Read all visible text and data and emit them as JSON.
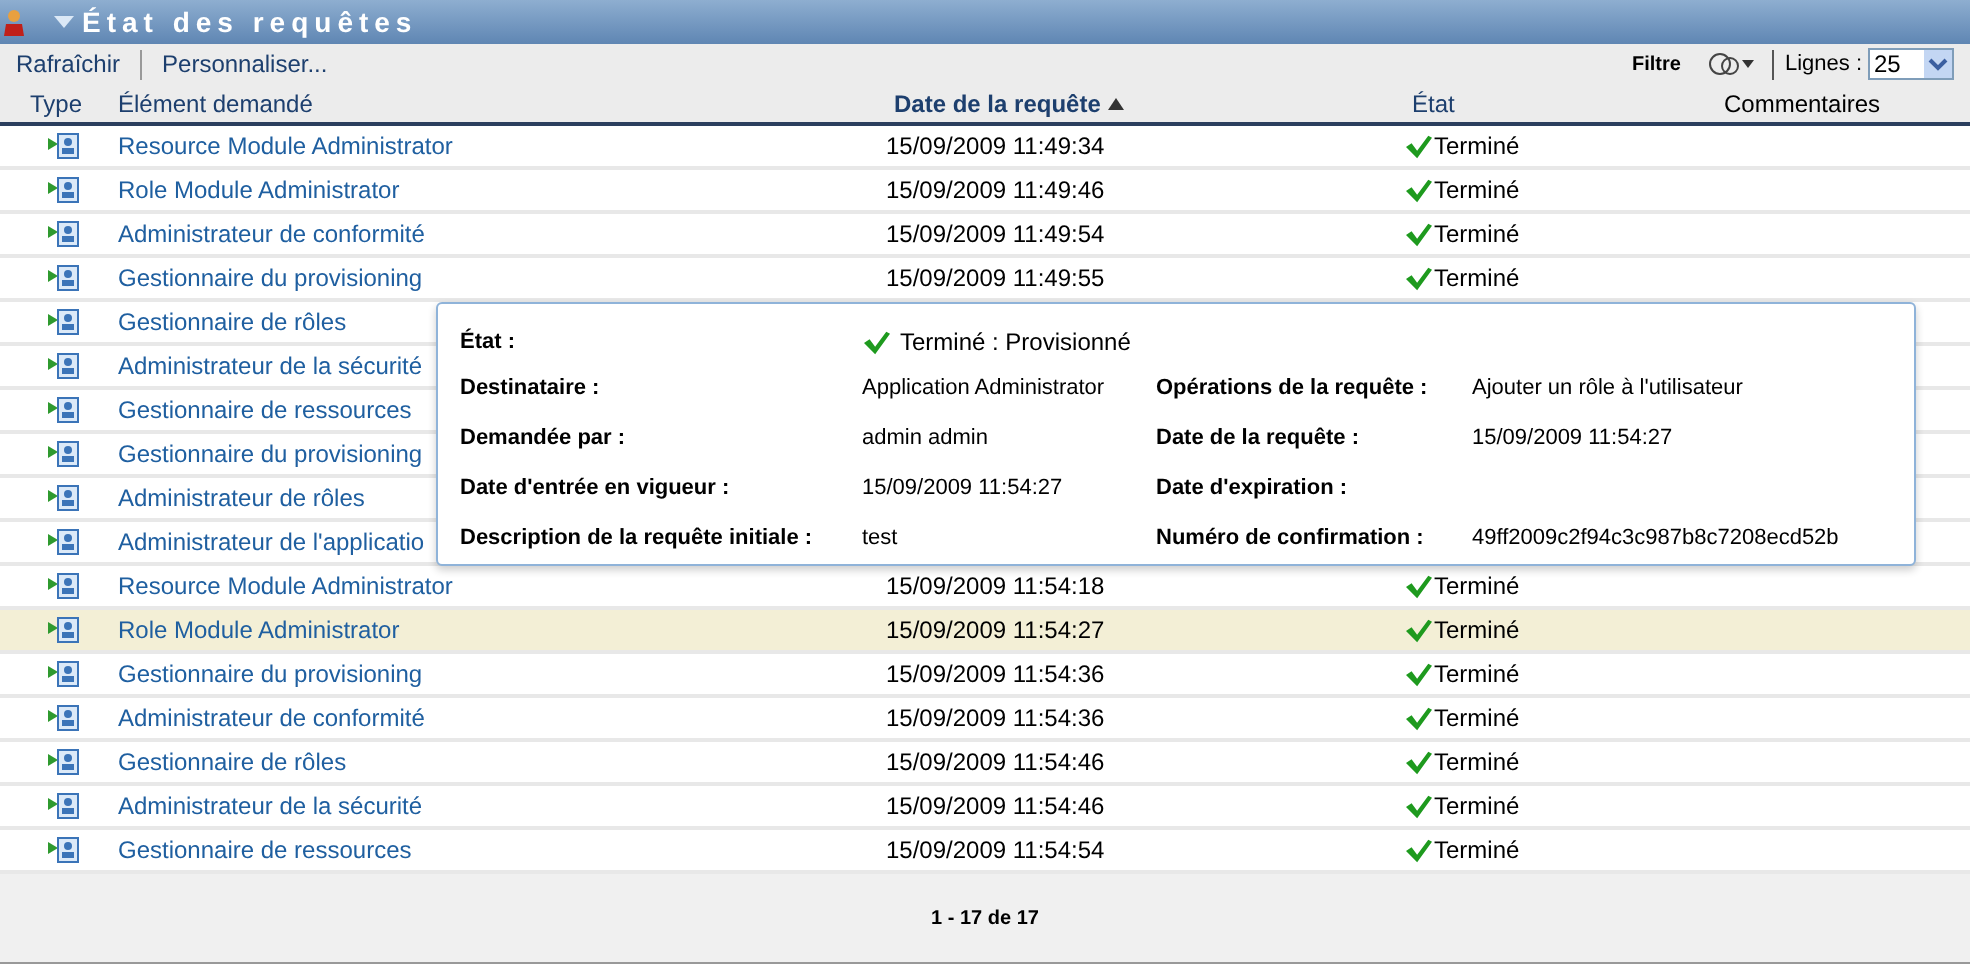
{
  "panel": {
    "title": "État des requêtes",
    "expanded": true
  },
  "toolbar": {
    "actions": [
      "Rafraîchir",
      "Personnaliser..."
    ],
    "filter_label": "Filtre",
    "lines_label": "Lignes :",
    "lines_value": "25"
  },
  "table": {
    "columns": [
      {
        "label": "Type",
        "sorted": false
      },
      {
        "label": "Élément demandé",
        "sorted": false
      },
      {
        "label": "Date de la requête",
        "sorted": true
      },
      {
        "label": "État",
        "sorted": false
      },
      {
        "label": "Commentaires",
        "sorted": false
      }
    ],
    "rows": [
      {
        "item": "Resource Module Administrator",
        "date": "15/09/2009 11:49:34",
        "status": "Terminé",
        "selected": false
      },
      {
        "item": "Role Module Administrator",
        "date": "15/09/2009 11:49:46",
        "status": "Terminé",
        "selected": false
      },
      {
        "item": "Administrateur de conformité",
        "date": "15/09/2009 11:49:54",
        "status": "Terminé",
        "selected": false
      },
      {
        "item": "Gestionnaire du provisioning",
        "date": "15/09/2009 11:49:55",
        "status": "Terminé",
        "selected": false
      },
      {
        "item": "Gestionnaire de rôles",
        "selected": false
      },
      {
        "item": "Administrateur de la sécurité",
        "selected": false
      },
      {
        "item": "Gestionnaire de ressources",
        "selected": false
      },
      {
        "item": "Gestionnaire du provisioning",
        "selected": false
      },
      {
        "item": "Administrateur de rôles",
        "selected": false
      },
      {
        "item": "Administrateur de l'applicatio",
        "selected": false
      },
      {
        "item": "Resource Module Administrator",
        "date": "15/09/2009 11:54:18",
        "status": "Terminé",
        "selected": false
      },
      {
        "item": "Role Module Administrator",
        "date": "15/09/2009 11:54:27",
        "status": "Terminé",
        "selected": true
      },
      {
        "item": "Gestionnaire du provisioning",
        "date": "15/09/2009 11:54:36",
        "status": "Terminé",
        "selected": false
      },
      {
        "item": "Administrateur de conformité",
        "date": "15/09/2009 11:54:36",
        "status": "Terminé",
        "selected": false
      },
      {
        "item": "Gestionnaire de rôles",
        "date": "15/09/2009 11:54:46",
        "status": "Terminé",
        "selected": false
      },
      {
        "item": "Administrateur de la sécurité",
        "date": "15/09/2009 11:54:46",
        "status": "Terminé",
        "selected": false
      },
      {
        "item": "Gestionnaire de ressources",
        "date": "15/09/2009 11:54:54",
        "status": "Terminé",
        "selected": false
      }
    ]
  },
  "popup": {
    "status_label": "État :",
    "status_value": "Terminé : Provisionné",
    "fields": [
      {
        "label": "Destinataire :",
        "value": "Application Administrator"
      },
      {
        "label": "Opérations de la requête :",
        "value": "Ajouter un rôle à l'utilisateur"
      },
      {
        "label": "Demandée par :",
        "value": "admin admin"
      },
      {
        "label": "Date de la requête :",
        "value": "15/09/2009 11:54:27"
      },
      {
        "label": "Date d'entrée en vigueur :",
        "value": "15/09/2009 11:54:27"
      },
      {
        "label": "Date d'expiration :"
      },
      {
        "label": "Description de la requête initiale :",
        "value": "test"
      },
      {
        "label": "Numéro de confirmation :",
        "value": "49ff2009c2f94c3c987b8c7208ecd52b"
      }
    ]
  },
  "pagination": "1 - 17 de 17"
}
